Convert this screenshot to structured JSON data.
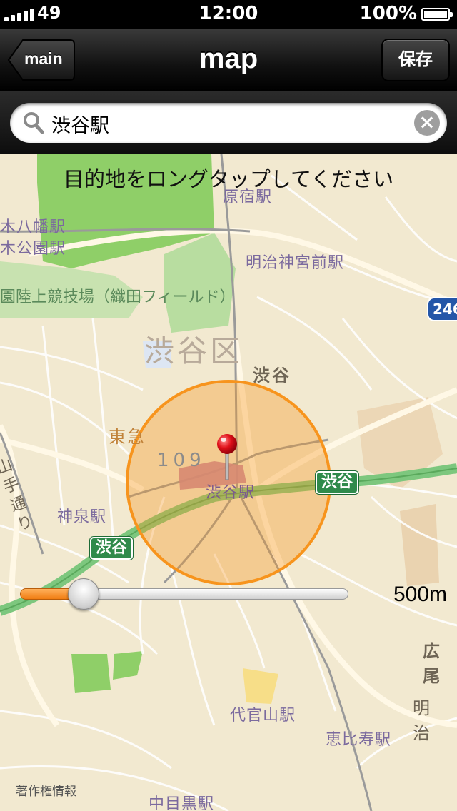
{
  "status_bar": {
    "carrier": "49",
    "time": "12:00",
    "battery": "100%",
    "battery_level": 1.0,
    "signal_bars": 5
  },
  "nav": {
    "back_label": "main",
    "title": "map",
    "save_label": "保存"
  },
  "search": {
    "value": "渋谷駅",
    "clear_icon": "clear-icon"
  },
  "map": {
    "instruction": "目的地をロングタップしてください",
    "ward": "渋谷区",
    "area": "渋谷",
    "labels": {
      "harajuku": "原宿駅",
      "yoyogi_hachiman": "木八幡駅",
      "yoyogi_park": "木公園駅",
      "meiji_jingumae": "明治神宮前駅",
      "stadium": "園陸上競技場（織田フィールド）",
      "tokyu": "東急",
      "label_109": "109",
      "shibuya_station": "渋谷駅",
      "shinsen": "神泉駅",
      "daikanyama": "代官山駅",
      "ebisu": "恵比寿駅",
      "nakameguro": "中目黒駅",
      "hiroo": "広尾",
      "meiji_road": "明治",
      "yamate": "山手通り"
    },
    "highway_shields": [
      "渋谷",
      "渋谷"
    ],
    "route_shield": "246",
    "copyright": "著作権情報",
    "accent_color": "#f7941d"
  },
  "radius": {
    "label": "500m",
    "slider_value": 0.16
  }
}
